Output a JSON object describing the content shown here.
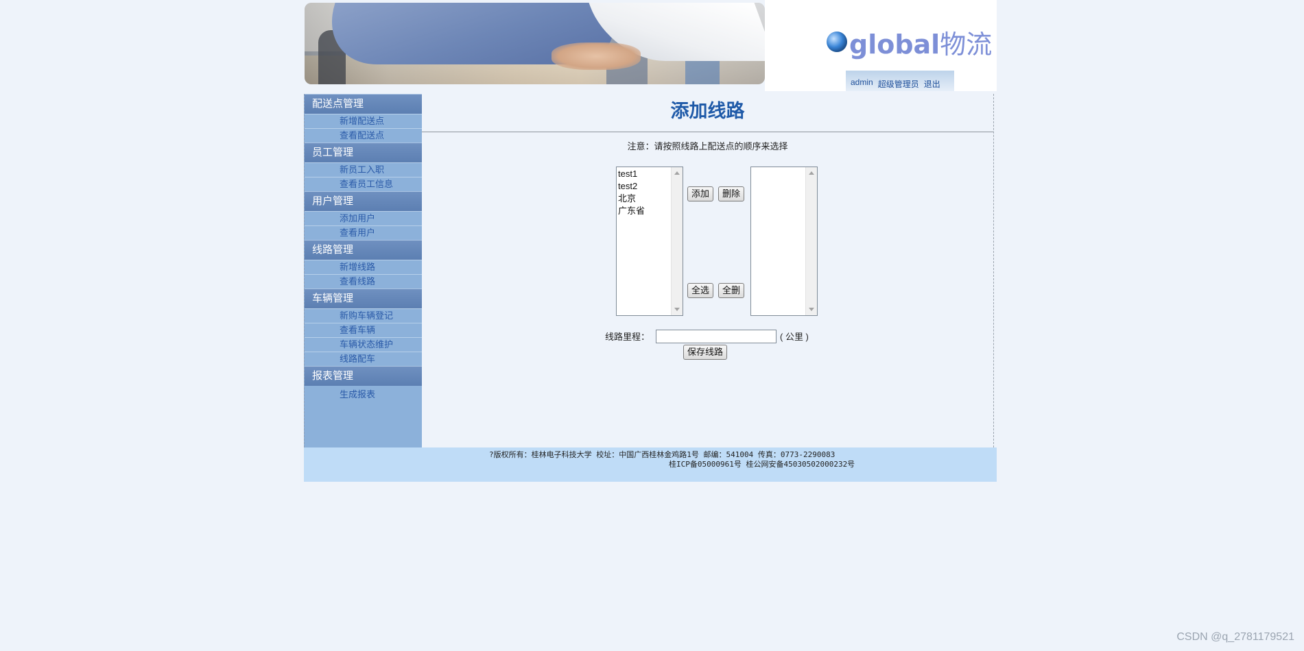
{
  "header": {
    "logo_latin": "global",
    "logo_cn": "物流",
    "user": "admin",
    "role": "超级管理员",
    "logout": "退出"
  },
  "sidebar": {
    "groups": [
      {
        "title": "配送点管理",
        "items": [
          "新增配送点",
          "查看配送点"
        ]
      },
      {
        "title": "员工管理",
        "items": [
          "新员工入职",
          "查看员工信息"
        ]
      },
      {
        "title": "用户管理",
        "items": [
          "添加用户",
          "查看用户"
        ]
      },
      {
        "title": "线路管理",
        "items": [
          "新增线路",
          "查看线路"
        ]
      },
      {
        "title": "车辆管理",
        "items": [
          "新购车辆登记",
          "查看车辆",
          "车辆状态维护",
          "线路配车"
        ]
      },
      {
        "title": "报表管理",
        "items": [
          "生成报表"
        ]
      }
    ]
  },
  "main": {
    "title": "添加线路",
    "note": "注意：请按照线路上配送点的顺序来选择",
    "source_options": [
      "test1",
      "test2",
      "北京",
      "广东省"
    ],
    "selected_options": [],
    "buttons": {
      "add": "添加",
      "delete": "删除",
      "select_all": "全选",
      "delete_all": "全删",
      "save": "保存线路"
    },
    "mileage_label": "线路里程：",
    "mileage_value": "",
    "mileage_unit": "( 公里 )"
  },
  "footer": {
    "line1": "?版权所有：桂林电子科技大学   校址：中国广西桂林金鸡路1号   邮编：541004   传真：0773-2290083",
    "line2": "桂ICP备05000961号     桂公网安备45030502000232号"
  },
  "watermark": "CSDN @q_2781179521",
  "colors": {
    "page_bg": "#eef3fa",
    "sidebar_bg": "#8cb1da",
    "menu_head": "#5c7fb2",
    "title_blue": "#1f5aa8",
    "footer_bg": "#bfdcf7"
  }
}
